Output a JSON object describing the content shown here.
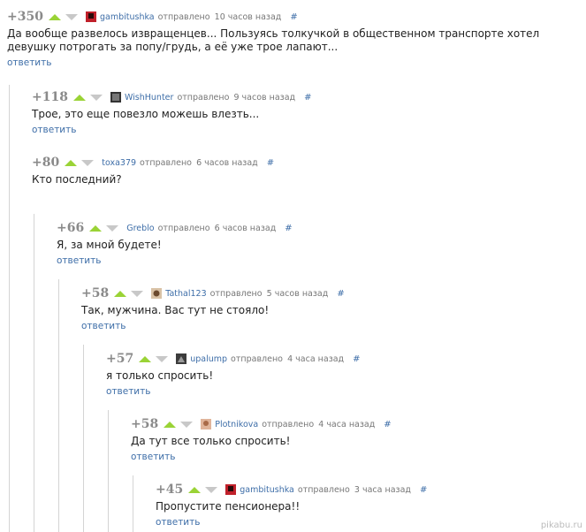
{
  "reply_label": "ответить",
  "sent_label": "отправлено",
  "hash_label": "#",
  "watermark": "pikabu.ru",
  "colors": {
    "up_arrow": "#9ad336",
    "down_arrow": "#c8c8c8",
    "link": "#3e6ea8"
  },
  "comments": [
    {
      "rating": "+350",
      "user": "gambitushka",
      "time": "10 часов назад",
      "text": "Да вообще развелось извращенцев... Пользуясь толкучкой в общественном транспорте хотел девушку потрогать за попу/грудь, а её уже трое лапают...",
      "avatar": "red"
    },
    {
      "rating": "+118",
      "user": "WishHunter",
      "time": "9 часов назад",
      "text": "Трое, это еще повезло можешь влезть...",
      "avatar": "dark"
    },
    {
      "rating": "+80",
      "user": "toxa379",
      "time": "6 часов назад",
      "text": "Кто последний?",
      "avatar": "none"
    },
    {
      "rating": "+66",
      "user": "Greblo",
      "time": "6 часов назад",
      "text": "Я, за мной будете!",
      "avatar": "none"
    },
    {
      "rating": "+58",
      "user": "Tathal123",
      "time": "5 часов назад",
      "text": "Так, мужчина. Вас тут не стояло!",
      "avatar": "face"
    },
    {
      "rating": "+57",
      "user": "upalump",
      "time": "4 часа назад",
      "text": "я только спросить!",
      "avatar": "dark"
    },
    {
      "rating": "+58",
      "user": "Plotnikova",
      "time": "4 часа назад",
      "text": "Да тут все только спросить!",
      "avatar": "face"
    },
    {
      "rating": "+45",
      "user": "gambitushka",
      "time": "3 часа назад",
      "text": "Пропустите пенсионера!!",
      "avatar": "red"
    }
  ]
}
